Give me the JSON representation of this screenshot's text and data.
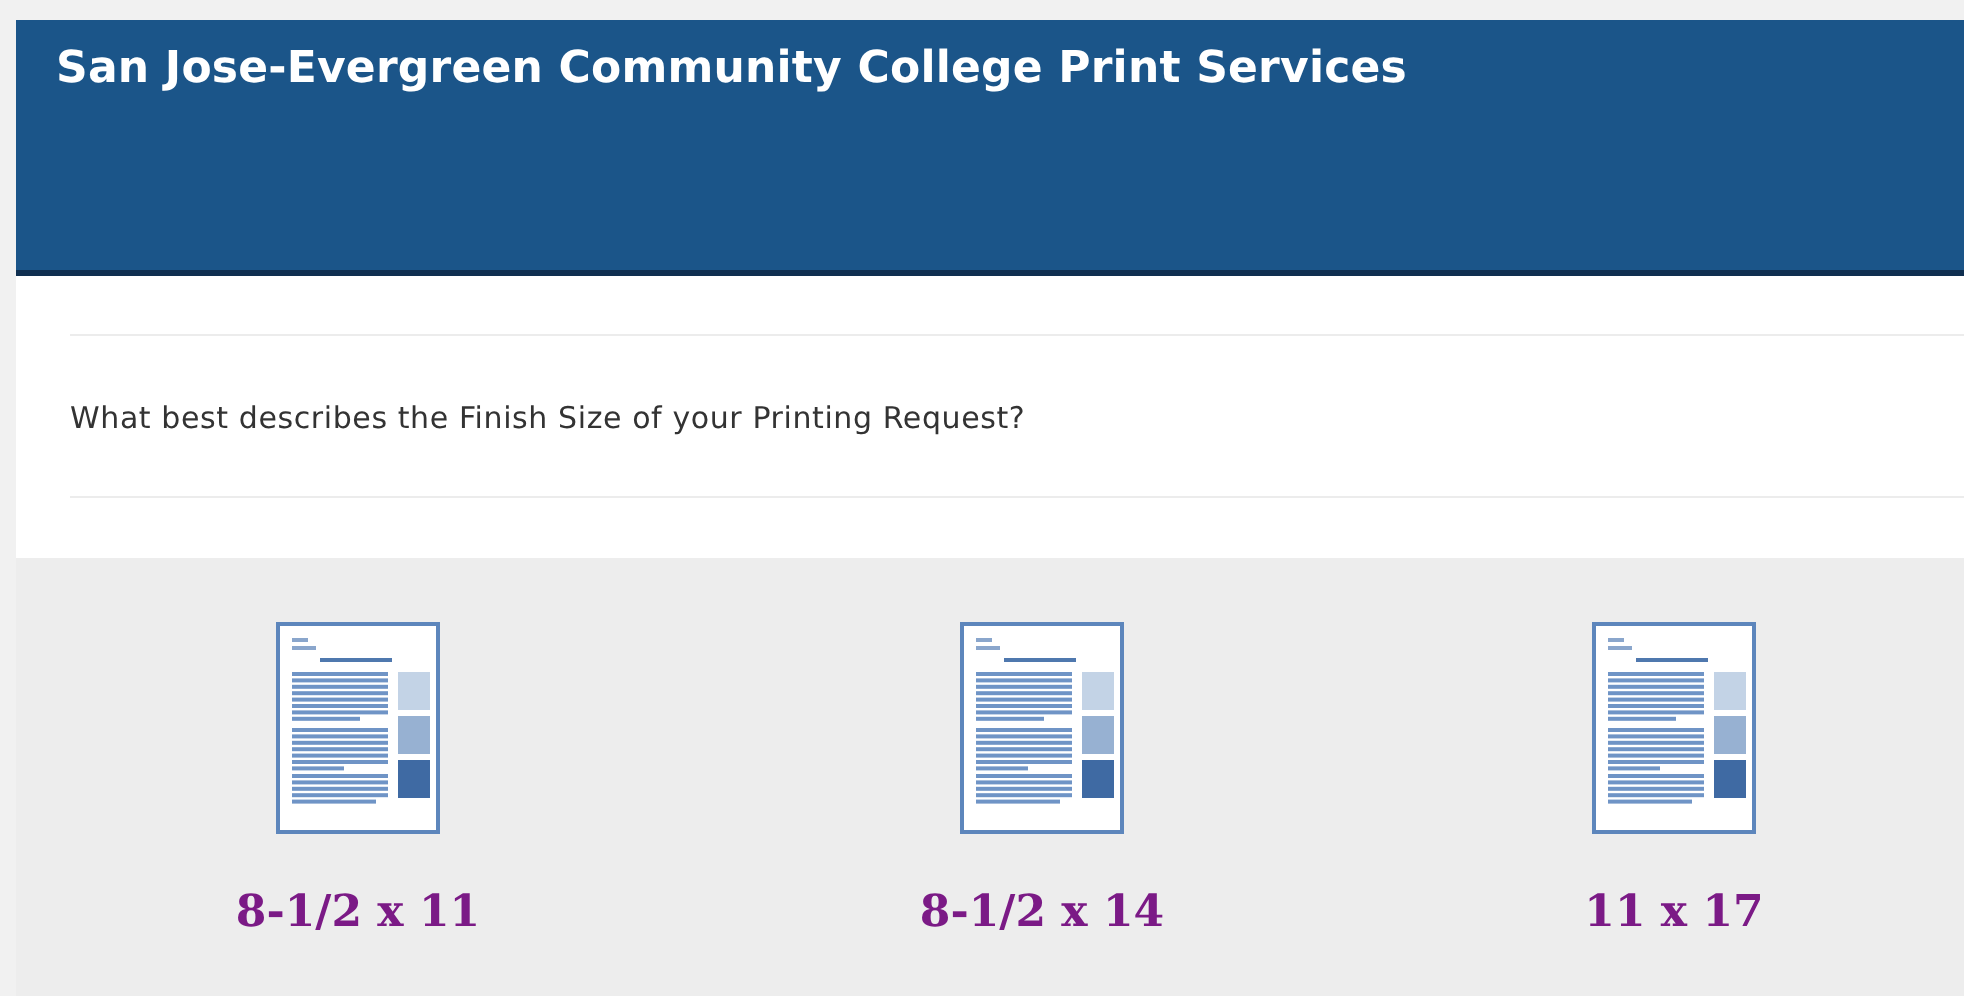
{
  "header": {
    "title": "San Jose-Evergreen Community College Print Services"
  },
  "question": "What best describes the Finish Size of your Printing Request?",
  "sizes": [
    {
      "label": "8-1/2 x 11"
    },
    {
      "label": "8-1/2 x 14"
    },
    {
      "label": "11 x 17"
    }
  ]
}
